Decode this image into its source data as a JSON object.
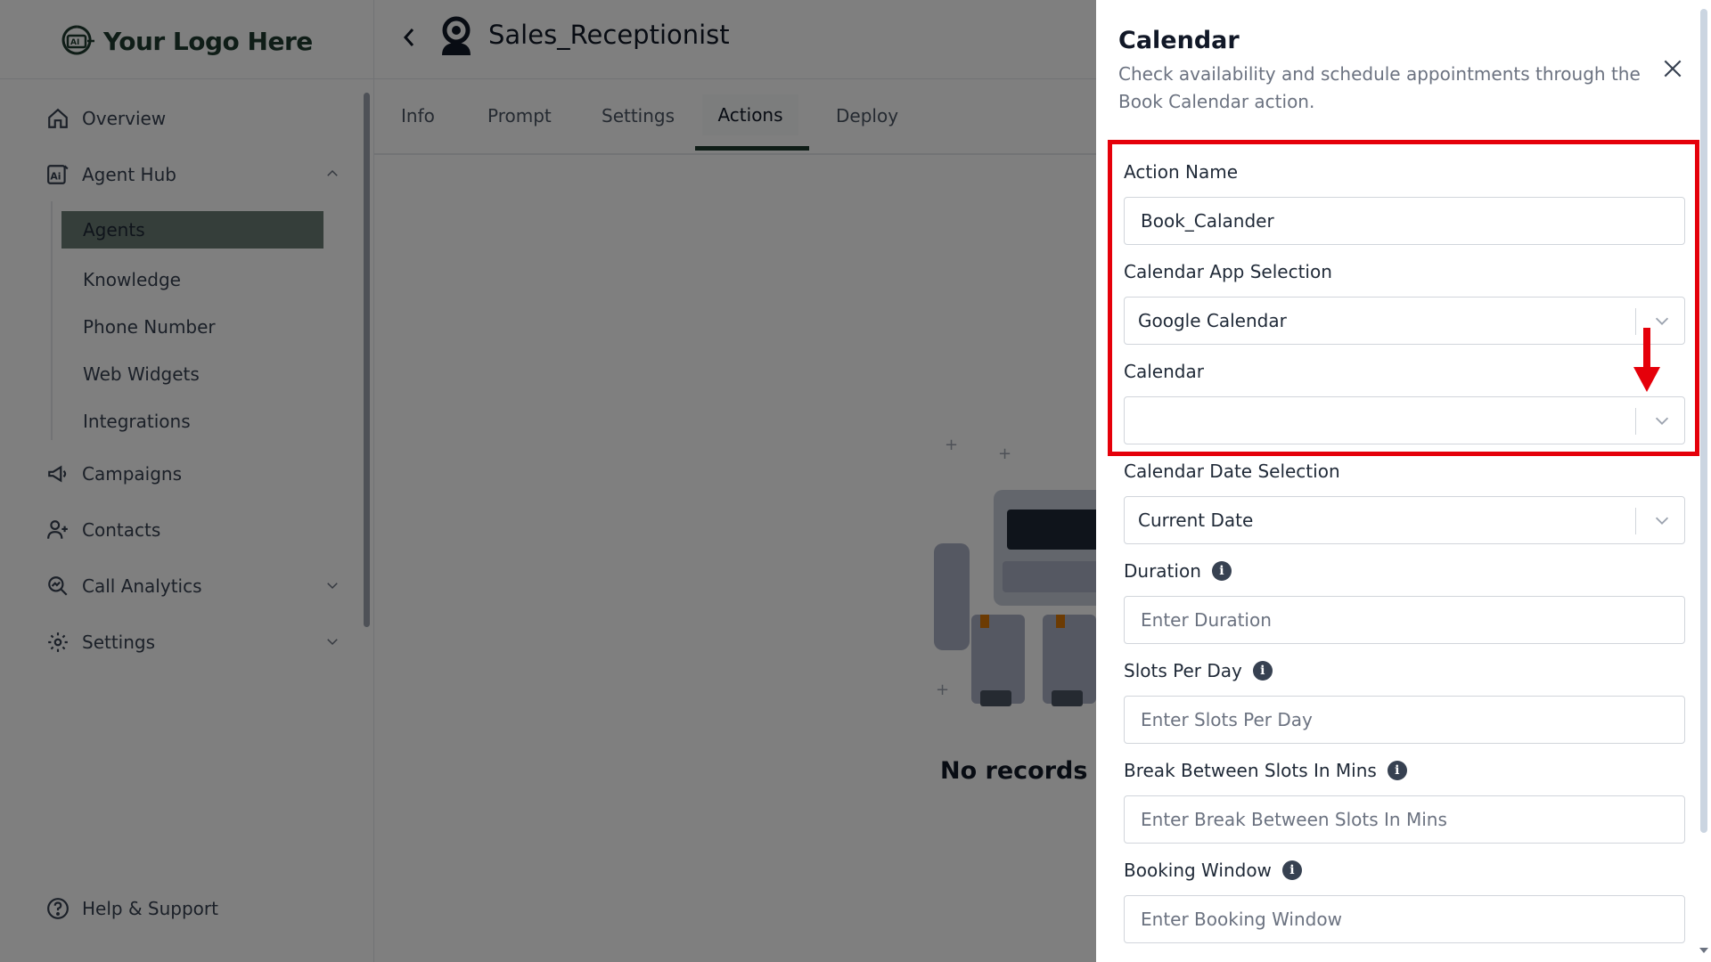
{
  "logo": {
    "text": "Your Logo Here",
    "mark": "AI"
  },
  "sidebar": {
    "items": [
      {
        "label": "Overview",
        "icon": "home-icon"
      },
      {
        "label": "Agent Hub",
        "icon": "agent-hub-icon"
      },
      {
        "label": "Campaigns",
        "icon": "megaphone-icon"
      },
      {
        "label": "Contacts",
        "icon": "user-plus-icon"
      },
      {
        "label": "Call Analytics",
        "icon": "analytics-icon"
      },
      {
        "label": "Settings",
        "icon": "settings-icon"
      }
    ],
    "sub_items": [
      "Agents",
      "Knowledge",
      "Phone Number",
      "Web Widgets",
      "Integrations"
    ],
    "active_sub": "Agents",
    "help": "Help & Support"
  },
  "header": {
    "agent_name": "Sales_Receptionist"
  },
  "tabs": [
    "Info",
    "Prompt",
    "Settings",
    "Actions",
    "Deploy"
  ],
  "active_tab": "Actions",
  "empty_state": "No records fo",
  "drawer": {
    "title": "Calendar",
    "description": "Check availability and schedule appointments through the Book Calendar action.",
    "fields": {
      "action_name": {
        "label": "Action Name",
        "value": "Book_Calander"
      },
      "calendar_app": {
        "label": "Calendar App Selection",
        "value": "Google Calendar"
      },
      "calendar": {
        "label": "Calendar",
        "value": ""
      },
      "date_selection": {
        "label": "Calendar Date Selection",
        "value": "Current Date"
      },
      "duration": {
        "label": "Duration",
        "placeholder": "Enter Duration"
      },
      "slots_per_day": {
        "label": "Slots Per Day",
        "placeholder": "Enter Slots Per Day"
      },
      "break_between": {
        "label": "Break Between Slots In Mins",
        "placeholder": "Enter Break Between Slots In Mins"
      },
      "booking_window": {
        "label": "Booking Window",
        "placeholder": "Enter Booking Window"
      }
    }
  },
  "colors": {
    "brand": "#1e3a2f",
    "highlight": "#e5000a",
    "overlay": "rgba(0,0,0,0.5)"
  }
}
